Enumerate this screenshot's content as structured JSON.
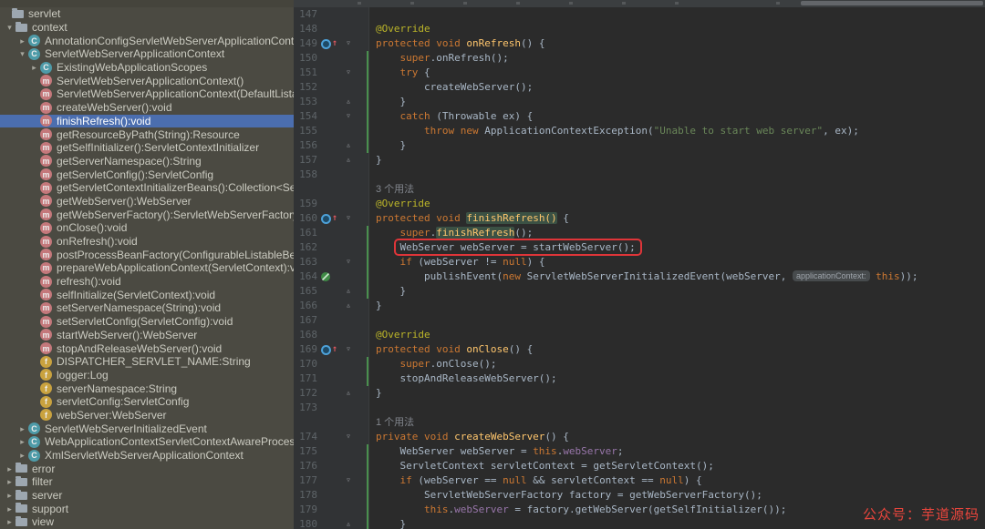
{
  "colors": {
    "selection": "#4B6EAF",
    "red_box": "#DF3539",
    "vcs_added": "#4A8F4E",
    "watermark_red": "#E8453C"
  },
  "icons": {
    "fold_down": "▿",
    "fold_up": "▵",
    "chevron_right": "▸",
    "chevron_down": "▾",
    "override_arrow": "↑",
    "class_letter": "C",
    "method_letter": "m",
    "field_letter": "f"
  },
  "structure_panel": {
    "items": [
      {
        "label": "servlet",
        "type": "folder",
        "level": 0,
        "chevron": "none"
      },
      {
        "label": "context",
        "type": "folder",
        "level": 1,
        "chevron": "down"
      },
      {
        "label": "AnnotationConfigServletWebServerApplicationContext",
        "type": "class",
        "level": 2,
        "chevron": "right"
      },
      {
        "label": "ServletWebServerApplicationContext",
        "type": "class",
        "level": 2,
        "chevron": "down"
      },
      {
        "label": "ExistingWebApplicationScopes",
        "type": "class",
        "level": 3,
        "chevron": "right"
      },
      {
        "label": "ServletWebServerApplicationContext()",
        "type": "method",
        "level": 3,
        "chevron": "none"
      },
      {
        "label": "ServletWebServerApplicationContext(DefaultListableBeanFactory)",
        "type": "method",
        "level": 3,
        "chevron": "none"
      },
      {
        "label": "createWebServer():void",
        "type": "method",
        "level": 3,
        "chevron": "none"
      },
      {
        "label": "finishRefresh():void",
        "type": "method",
        "level": 3,
        "chevron": "none",
        "selected": true
      },
      {
        "label": "getResourceByPath(String):Resource",
        "type": "method",
        "level": 3,
        "chevron": "none"
      },
      {
        "label": "getSelfInitializer():ServletContextInitializer",
        "type": "method",
        "level": 3,
        "chevron": "none"
      },
      {
        "label": "getServerNamespace():String",
        "type": "method",
        "level": 3,
        "chevron": "none"
      },
      {
        "label": "getServletConfig():ServletConfig",
        "type": "method",
        "level": 3,
        "chevron": "none"
      },
      {
        "label": "getServletContextInitializerBeans():Collection<ServletContextInitializer>",
        "type": "method",
        "level": 3,
        "chevron": "none"
      },
      {
        "label": "getWebServer():WebServer",
        "type": "method",
        "level": 3,
        "chevron": "none"
      },
      {
        "label": "getWebServerFactory():ServletWebServerFactory",
        "type": "method",
        "level": 3,
        "chevron": "none"
      },
      {
        "label": "onClose():void",
        "type": "method",
        "level": 3,
        "chevron": "none"
      },
      {
        "label": "onRefresh():void",
        "type": "method",
        "level": 3,
        "chevron": "none"
      },
      {
        "label": "postProcessBeanFactory(ConfigurableListableBeanFactory):void",
        "type": "method",
        "level": 3,
        "chevron": "none"
      },
      {
        "label": "prepareWebApplicationContext(ServletContext):void",
        "type": "method",
        "level": 3,
        "chevron": "none"
      },
      {
        "label": "refresh():void",
        "type": "method",
        "level": 3,
        "chevron": "none"
      },
      {
        "label": "selfInitialize(ServletContext):void",
        "type": "method",
        "level": 3,
        "chevron": "none"
      },
      {
        "label": "setServerNamespace(String):void",
        "type": "method",
        "level": 3,
        "chevron": "none"
      },
      {
        "label": "setServletConfig(ServletConfig):void",
        "type": "method",
        "level": 3,
        "chevron": "none"
      },
      {
        "label": "startWebServer():WebServer",
        "type": "method",
        "level": 3,
        "chevron": "none"
      },
      {
        "label": "stopAndReleaseWebServer():void",
        "type": "method",
        "level": 3,
        "chevron": "none"
      },
      {
        "label": "DISPATCHER_SERVLET_NAME:String",
        "type": "field",
        "level": 3,
        "chevron": "none"
      },
      {
        "label": "logger:Log",
        "type": "field",
        "level": 3,
        "chevron": "none"
      },
      {
        "label": "serverNamespace:String",
        "type": "field",
        "level": 3,
        "chevron": "none"
      },
      {
        "label": "servletConfig:ServletConfig",
        "type": "field",
        "level": 3,
        "chevron": "none"
      },
      {
        "label": "webServer:WebServer",
        "type": "field",
        "level": 3,
        "chevron": "none"
      },
      {
        "label": "ServletWebServerInitializedEvent",
        "type": "class",
        "level": 2,
        "chevron": "right"
      },
      {
        "label": "WebApplicationContextServletContextAwareProcessor",
        "type": "class",
        "level": 2,
        "chevron": "right"
      },
      {
        "label": "XmlServletWebServerApplicationContext",
        "type": "class",
        "level": 2,
        "chevron": "right"
      },
      {
        "label": "error",
        "type": "folder",
        "level": 1,
        "chevron": "right"
      },
      {
        "label": "filter",
        "type": "folder",
        "level": 1,
        "chevron": "right"
      },
      {
        "label": "server",
        "type": "folder",
        "level": 1,
        "chevron": "right"
      },
      {
        "label": "support",
        "type": "folder",
        "level": 1,
        "chevron": "right"
      },
      {
        "label": "view",
        "type": "folder",
        "level": 1,
        "chevron": "right"
      }
    ]
  },
  "editor": {
    "rows": [
      {
        "n": "147",
        "seg": []
      },
      {
        "n": "148",
        "seg": [
          {
            "c": "a",
            "t": "@Override"
          }
        ]
      },
      {
        "n": "149",
        "icon": "override",
        "fold": "down",
        "seg": [
          {
            "c": "k",
            "t": "protected void "
          },
          {
            "c": "d",
            "t": "onRefresh"
          },
          {
            "c": "p",
            "t": "() {"
          }
        ]
      },
      {
        "n": "150",
        "vcs": true,
        "seg": [
          {
            "c": "p",
            "t": "    "
          },
          {
            "c": "k",
            "t": "super"
          },
          {
            "c": "p",
            "t": ".onRefresh();"
          }
        ]
      },
      {
        "n": "151",
        "vcs": true,
        "fold": "down",
        "seg": [
          {
            "c": "p",
            "t": "    "
          },
          {
            "c": "k",
            "t": "try"
          },
          {
            "c": "p",
            "t": " {"
          }
        ]
      },
      {
        "n": "152",
        "vcs": true,
        "seg": [
          {
            "c": "p",
            "t": "        createWebServer();"
          }
        ]
      },
      {
        "n": "153",
        "vcs": true,
        "fold": "up",
        "seg": [
          {
            "c": "p",
            "t": "    }"
          }
        ]
      },
      {
        "n": "154",
        "vcs": true,
        "fold": "down",
        "seg": [
          {
            "c": "p",
            "t": "    "
          },
          {
            "c": "k",
            "t": "catch"
          },
          {
            "c": "p",
            "t": " (Throwable ex) {"
          }
        ]
      },
      {
        "n": "155",
        "vcs": true,
        "seg": [
          {
            "c": "p",
            "t": "        "
          },
          {
            "c": "k",
            "t": "throw new "
          },
          {
            "c": "p",
            "t": "ApplicationContextException("
          },
          {
            "c": "s",
            "t": "\"Unable to start web server\""
          },
          {
            "c": "p",
            "t": ", ex);"
          }
        ]
      },
      {
        "n": "156",
        "vcs": true,
        "fold": "up",
        "seg": [
          {
            "c": "p",
            "t": "    }"
          }
        ]
      },
      {
        "n": "157",
        "fold": "up",
        "seg": [
          {
            "c": "p",
            "t": "}"
          }
        ]
      },
      {
        "n": "158",
        "seg": []
      },
      {
        "n": "",
        "seg": [
          {
            "c": "g",
            "t": "3 个用法"
          }
        ]
      },
      {
        "n": "159",
        "seg": [
          {
            "c": "a",
            "t": "@Override"
          }
        ]
      },
      {
        "n": "160",
        "icon": "override",
        "fold": "down",
        "seg": [
          {
            "c": "k",
            "t": "protected void "
          },
          {
            "c": "hl",
            "t": "finishRefresh()"
          },
          {
            "c": "p",
            "t": " {"
          }
        ]
      },
      {
        "n": "161",
        "vcs": true,
        "seg": [
          {
            "c": "p",
            "t": "    "
          },
          {
            "c": "k",
            "t": "super"
          },
          {
            "c": "p",
            "t": "."
          },
          {
            "c": "hl",
            "t": "finishRefresh"
          },
          {
            "c": "p",
            "t": "();"
          }
        ]
      },
      {
        "n": "162",
        "vcs": true,
        "seg": [
          {
            "c": "p",
            "t": "    "
          },
          {
            "c": "box",
            "t": "WebServer webServer = startWebServer();"
          }
        ]
      },
      {
        "n": "163",
        "vcs": true,
        "fold": "down",
        "seg": [
          {
            "c": "p",
            "t": "    "
          },
          {
            "c": "k",
            "t": "if"
          },
          {
            "c": "p",
            "t": " (webServer != "
          },
          {
            "c": "k",
            "t": "null"
          },
          {
            "c": "p",
            "t": ") {"
          }
        ]
      },
      {
        "n": "164",
        "vcs": true,
        "icon": "event",
        "seg": [
          {
            "c": "p",
            "t": "        publishEvent("
          },
          {
            "c": "k",
            "t": "new "
          },
          {
            "c": "p",
            "t": "ServletWebServerInitializedEvent(webServer, "
          },
          {
            "c": "chip",
            "t": "applicationContext:"
          },
          {
            "c": "p",
            "t": " "
          },
          {
            "c": "k",
            "t": "this"
          },
          {
            "c": "p",
            "t": "));"
          }
        ]
      },
      {
        "n": "165",
        "vcs": true,
        "fold": "up",
        "seg": [
          {
            "c": "p",
            "t": "    }"
          }
        ]
      },
      {
        "n": "166",
        "fold": "up",
        "seg": [
          {
            "c": "p",
            "t": "}"
          }
        ]
      },
      {
        "n": "167",
        "seg": []
      },
      {
        "n": "168",
        "seg": [
          {
            "c": "a",
            "t": "@Override"
          }
        ]
      },
      {
        "n": "169",
        "icon": "override",
        "fold": "down",
        "seg": [
          {
            "c": "k",
            "t": "protected void "
          },
          {
            "c": "d",
            "t": "onClose"
          },
          {
            "c": "p",
            "t": "() {"
          }
        ]
      },
      {
        "n": "170",
        "vcs": true,
        "seg": [
          {
            "c": "p",
            "t": "    "
          },
          {
            "c": "k",
            "t": "super"
          },
          {
            "c": "p",
            "t": ".onClose();"
          }
        ]
      },
      {
        "n": "171",
        "vcs": true,
        "seg": [
          {
            "c": "p",
            "t": "    stopAndReleaseWebServer();"
          }
        ]
      },
      {
        "n": "172",
        "fold": "up",
        "seg": [
          {
            "c": "p",
            "t": "}"
          }
        ]
      },
      {
        "n": "173",
        "seg": []
      },
      {
        "n": "",
        "seg": [
          {
            "c": "g",
            "t": "1 个用法"
          }
        ]
      },
      {
        "n": "174",
        "fold": "down",
        "seg": [
          {
            "c": "k",
            "t": "private void "
          },
          {
            "c": "d",
            "t": "createWebServer"
          },
          {
            "c": "p",
            "t": "() {"
          }
        ]
      },
      {
        "n": "175",
        "vcs": true,
        "seg": [
          {
            "c": "p",
            "t": "    WebServer webServer = "
          },
          {
            "c": "k",
            "t": "this"
          },
          {
            "c": "p",
            "t": "."
          },
          {
            "c": "f",
            "t": "webServer"
          },
          {
            "c": "p",
            "t": ";"
          }
        ]
      },
      {
        "n": "176",
        "vcs": true,
        "seg": [
          {
            "c": "p",
            "t": "    ServletContext servletContext = getServletContext();"
          }
        ]
      },
      {
        "n": "177",
        "vcs": true,
        "fold": "down",
        "seg": [
          {
            "c": "p",
            "t": "    "
          },
          {
            "c": "k",
            "t": "if"
          },
          {
            "c": "p",
            "t": " (webServer == "
          },
          {
            "c": "k",
            "t": "null"
          },
          {
            "c": "p",
            "t": " && servletContext == "
          },
          {
            "c": "k",
            "t": "null"
          },
          {
            "c": "p",
            "t": ") {"
          }
        ]
      },
      {
        "n": "178",
        "vcs": true,
        "seg": [
          {
            "c": "p",
            "t": "        ServletWebServerFactory factory = getWebServerFactory();"
          }
        ]
      },
      {
        "n": "179",
        "vcs": true,
        "seg": [
          {
            "c": "p",
            "t": "        "
          },
          {
            "c": "k",
            "t": "this"
          },
          {
            "c": "p",
            "t": "."
          },
          {
            "c": "f",
            "t": "webServer"
          },
          {
            "c": "p",
            "t": " = factory.getWebServer(getSelfInitializer());"
          }
        ]
      },
      {
        "n": "180",
        "vcs": true,
        "fold": "up",
        "seg": [
          {
            "c": "p",
            "t": "    }"
          }
        ]
      }
    ]
  },
  "watermark": {
    "text": "公众号：芋道源码"
  }
}
